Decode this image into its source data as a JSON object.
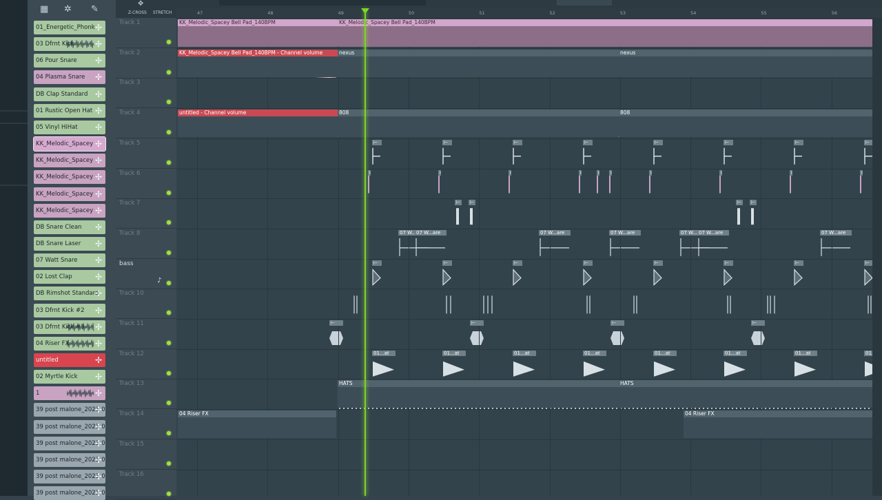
{
  "toolbar": {
    "zcross": "Z-CROSS",
    "stretch": "STRETCH"
  },
  "ruler": {
    "bars": [
      "47",
      "48",
      "49",
      "50",
      "51",
      "52",
      "53",
      "54",
      "55",
      "56"
    ]
  },
  "picker": {
    "items": [
      {
        "label": "01_Energetic_Phonk",
        "color": "#a9c9a1"
      },
      {
        "label": "03 Dfrnt Kick",
        "color": "#a9c9a1"
      },
      {
        "label": "06 Pour Snare",
        "color": "#a9c9a1"
      },
      {
        "label": "04 Plasma Snare",
        "color": "#c9a3c2"
      },
      {
        "label": "DB Clap Standard",
        "color": "#a9c9a1"
      },
      {
        "label": "01 Rustic Open Hat",
        "color": "#a9c9a1"
      },
      {
        "label": "05 Vinyl HiHat",
        "color": "#a9c9a1"
      },
      {
        "label": "KK_Melodic_Spacey",
        "color": "#d6a9cf"
      },
      {
        "label": "KK_Melodic_Spacey",
        "color": "#c9a3c2"
      },
      {
        "label": "KK_Melodic_Spacey",
        "color": "#c9a3c2"
      },
      {
        "label": "KK_Melodic_Spacey",
        "color": "#c9a3c2"
      },
      {
        "label": "KK_Melodic_Spacey",
        "color": "#c9a3c2"
      },
      {
        "label": "DB Snare Clean",
        "color": "#a9c9a1"
      },
      {
        "label": "DB Snare Laser",
        "color": "#a9c9a1"
      },
      {
        "label": "07 Watt Snare",
        "color": "#a9c9a1"
      },
      {
        "label": "02 Lost Clap",
        "color": "#a9c9a1"
      },
      {
        "label": "DB Rimshot Standard",
        "color": "#a9c9a1"
      },
      {
        "label": "03 Dfrnt Kick #2",
        "color": "#a9c9a1"
      },
      {
        "label": "03 Dfrnt Kick #3",
        "color": "#a9c9a1"
      },
      {
        "label": "04 Riser FX",
        "color": "#a9c9a1"
      },
      {
        "label": "untitled",
        "color": "#d8454f"
      },
      {
        "label": "02 Myrtle Kick",
        "color": "#a9c9a1"
      },
      {
        "label": "1",
        "color": "#c9a3c2"
      },
      {
        "label": "39 post malone_2023-03...",
        "color": "#9aa7ae"
      },
      {
        "label": "39 post malone_2023-03...",
        "color": "#9aa7ae"
      },
      {
        "label": "39 post malone_2023-04...",
        "color": "#9aa7ae"
      },
      {
        "label": "39 post malone_2023-04...",
        "color": "#9aa7ae"
      },
      {
        "label": "39 post malone_2023-04...",
        "color": "#9aa7ae"
      },
      {
        "label": "39 post malone_2023-04...",
        "color": "#9aa7ae"
      }
    ]
  },
  "tracks": [
    {
      "name": "Track 1"
    },
    {
      "name": "Track 2"
    },
    {
      "name": "Track 3"
    },
    {
      "name": "Track 4"
    },
    {
      "name": "Track 5"
    },
    {
      "name": "Track 6"
    },
    {
      "name": "Track 7"
    },
    {
      "name": "Track 8"
    },
    {
      "name": "bass"
    },
    {
      "name": "Track 10"
    },
    {
      "name": "Track 11"
    },
    {
      "name": "Track 12"
    },
    {
      "name": "Track 13"
    },
    {
      "name": "Track 14"
    },
    {
      "name": "Track 15"
    },
    {
      "name": "Track 16"
    }
  ],
  "clips": {
    "t1a": "KK_Melodic_Spacey Bell Pad_140BPM",
    "t1b": "KK_Melodic_Spacey Bell Pad_140BPM",
    "t2a": "KK_Melodic_Spacey Bell Pad_140BPM - Channel volume",
    "t2b": "nexus",
    "t2c": "nexus",
    "t4a": "untitled - Channel volume",
    "t4b": "808",
    "t4c": "808",
    "t8": "07 W...are",
    "t12": "01...at",
    "t13a": "HATS",
    "t13b": "HATS",
    "t14a": "04 Riser FX",
    "t14b": "04 Riser FX"
  },
  "colors": {
    "audio_clip": "#d3a6cc",
    "automation_clip": "#c94a54",
    "pattern_body": "#3d4d57",
    "pattern_title": "#51636d",
    "playhead": "#7ed321"
  }
}
